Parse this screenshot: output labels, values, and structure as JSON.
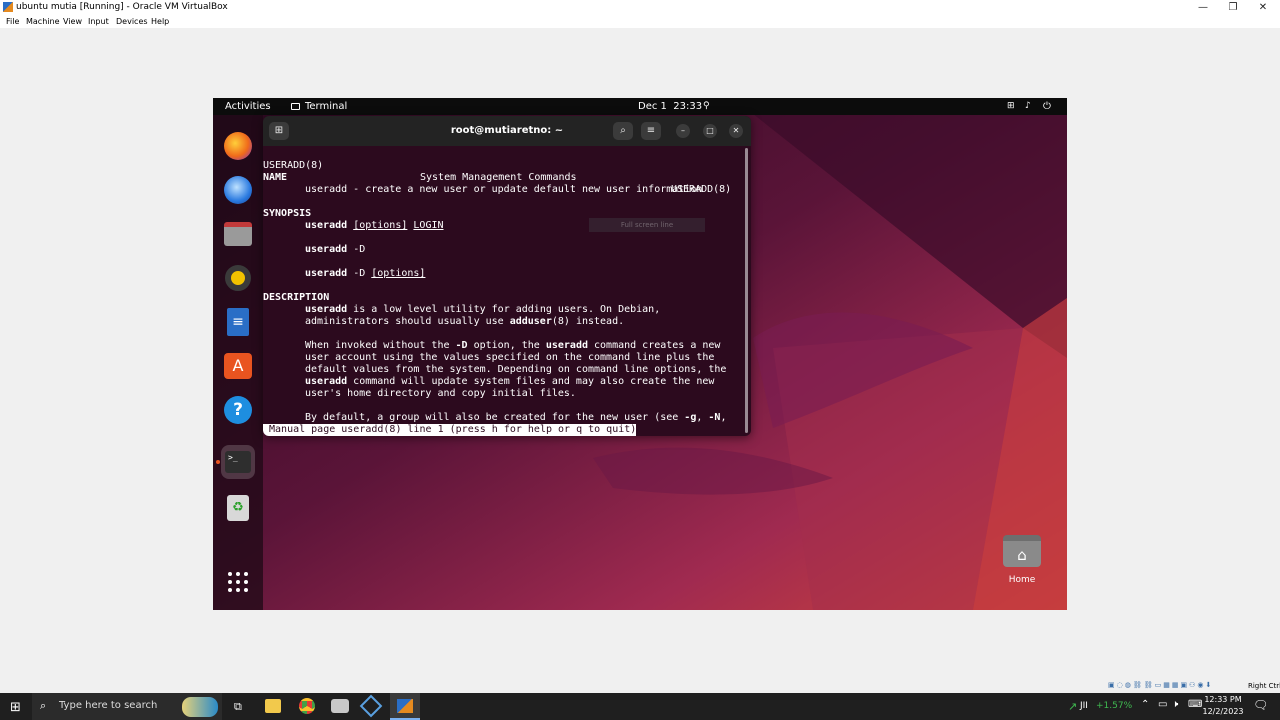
{
  "window": {
    "title": "ubuntu mutia [Running] - Oracle VM VirtualBox",
    "controls": [
      "—",
      "❐",
      "✕"
    ]
  },
  "menu": [
    "File",
    "Machine",
    "View",
    "Input",
    "Devices",
    "Help"
  ],
  "guest": {
    "topbar": {
      "activities": "Activities",
      "app": "Terminal",
      "clock": "Dec 1  23:33"
    },
    "terminal": {
      "title": "root@mutiaretno: ~",
      "overlay": "Full screen line",
      "lines": {
        "l0a": "USERADD(8)",
        "l0b": "System Management Commands",
        "l0c": "USERADD(8)",
        "l2": "NAME",
        "l3": "useradd - create a new user or update default new user information",
        "l5": "SYNOPSIS",
        "l6a": "useradd",
        "l6b": "[options]",
        "l6c": "LOGIN",
        "l8a": "useradd",
        "l8b": "-D",
        "l10a": "useradd",
        "l10b": "-D",
        "l10c": "[options]",
        "l12": "DESCRIPTION",
        "l13a": "useradd",
        "l13b": " is a low level utility for adding users. On Debian,",
        "l14a": "administrators should usually use ",
        "l14b": "adduser",
        "l14c": "(8) instead.",
        "l16a": "When invoked without the ",
        "l16b": "-D",
        "l16c": " option, the ",
        "l16d": "useradd",
        "l16e": " command creates a new",
        "l17": "user account using the values specified on the command line plus the",
        "l18": "default values from the system. Depending on command line options, the",
        "l19a": "useradd",
        "l19b": " command will update system files and may also create the new",
        "l20": "user's home directory and copy initial files.",
        "l22a": "By default, a group will also be created for the new user (see ",
        "l22b": "-g",
        "l22c": ", ",
        "l22d": "-N",
        "l22e": ",",
        "status": " Manual page useradd(8) line 1 (press h for help or q to quit)"
      }
    },
    "desktop_home": "Home"
  },
  "taskbar": {
    "search_placeholder": "Type here to search",
    "stock": "+1.57%",
    "stock_label": "JII",
    "time": "12:33 PM",
    "date": "12/2/2023",
    "host_key": "Right Ctrl"
  }
}
